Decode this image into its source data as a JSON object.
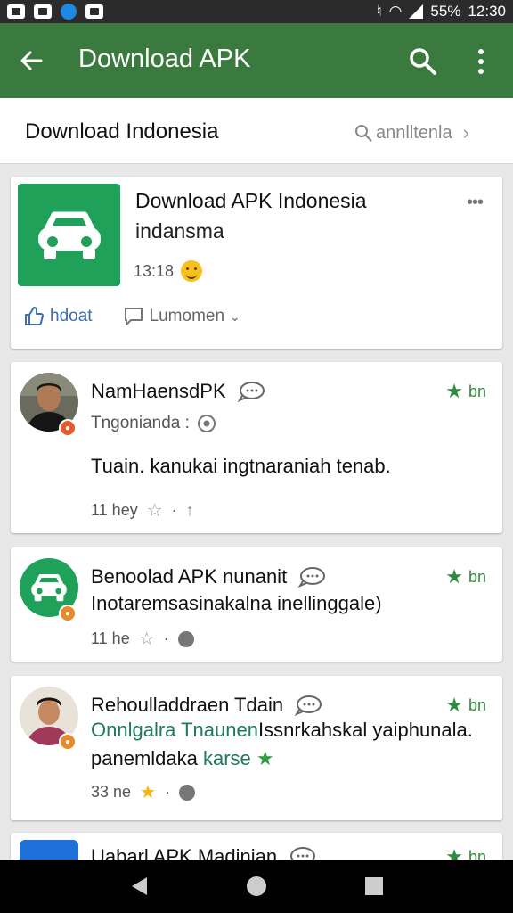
{
  "statusbar": {
    "battery": "55%",
    "time": "12:30"
  },
  "appbar": {
    "title": "Download APK"
  },
  "subheader": {
    "title": "Download Indonesia",
    "search_text": "annlltenla"
  },
  "post": {
    "title": "Download APK Indonesia",
    "subtitle": "indansma",
    "time": "13:18",
    "like_label": "hdoat",
    "comment_label": "Lumomen"
  },
  "comments": [
    {
      "name": "NamHaensdPK",
      "meta": "Tngonianda :",
      "text": "Tuain. kanukai ingtnaraniah tenab.",
      "time": "11 hey",
      "rating": "bn"
    },
    {
      "name": "Benoolad APK nunanit",
      "text": "Inotaremsasinakalna  inellinggale)",
      "time": "11 he",
      "rating": "bn"
    },
    {
      "name": "Rehoulladdraen Tdain",
      "text_green": "Onnlgalra Tnaunen",
      "text_rest": "Issnrkahskal yaiphunala.",
      "text2_a": "panemldaka",
      "text2_b": "karse",
      "time": "33 ne",
      "rating": "bn"
    },
    {
      "name": "Uabarl APK Madinian",
      "rating": "bn"
    }
  ]
}
